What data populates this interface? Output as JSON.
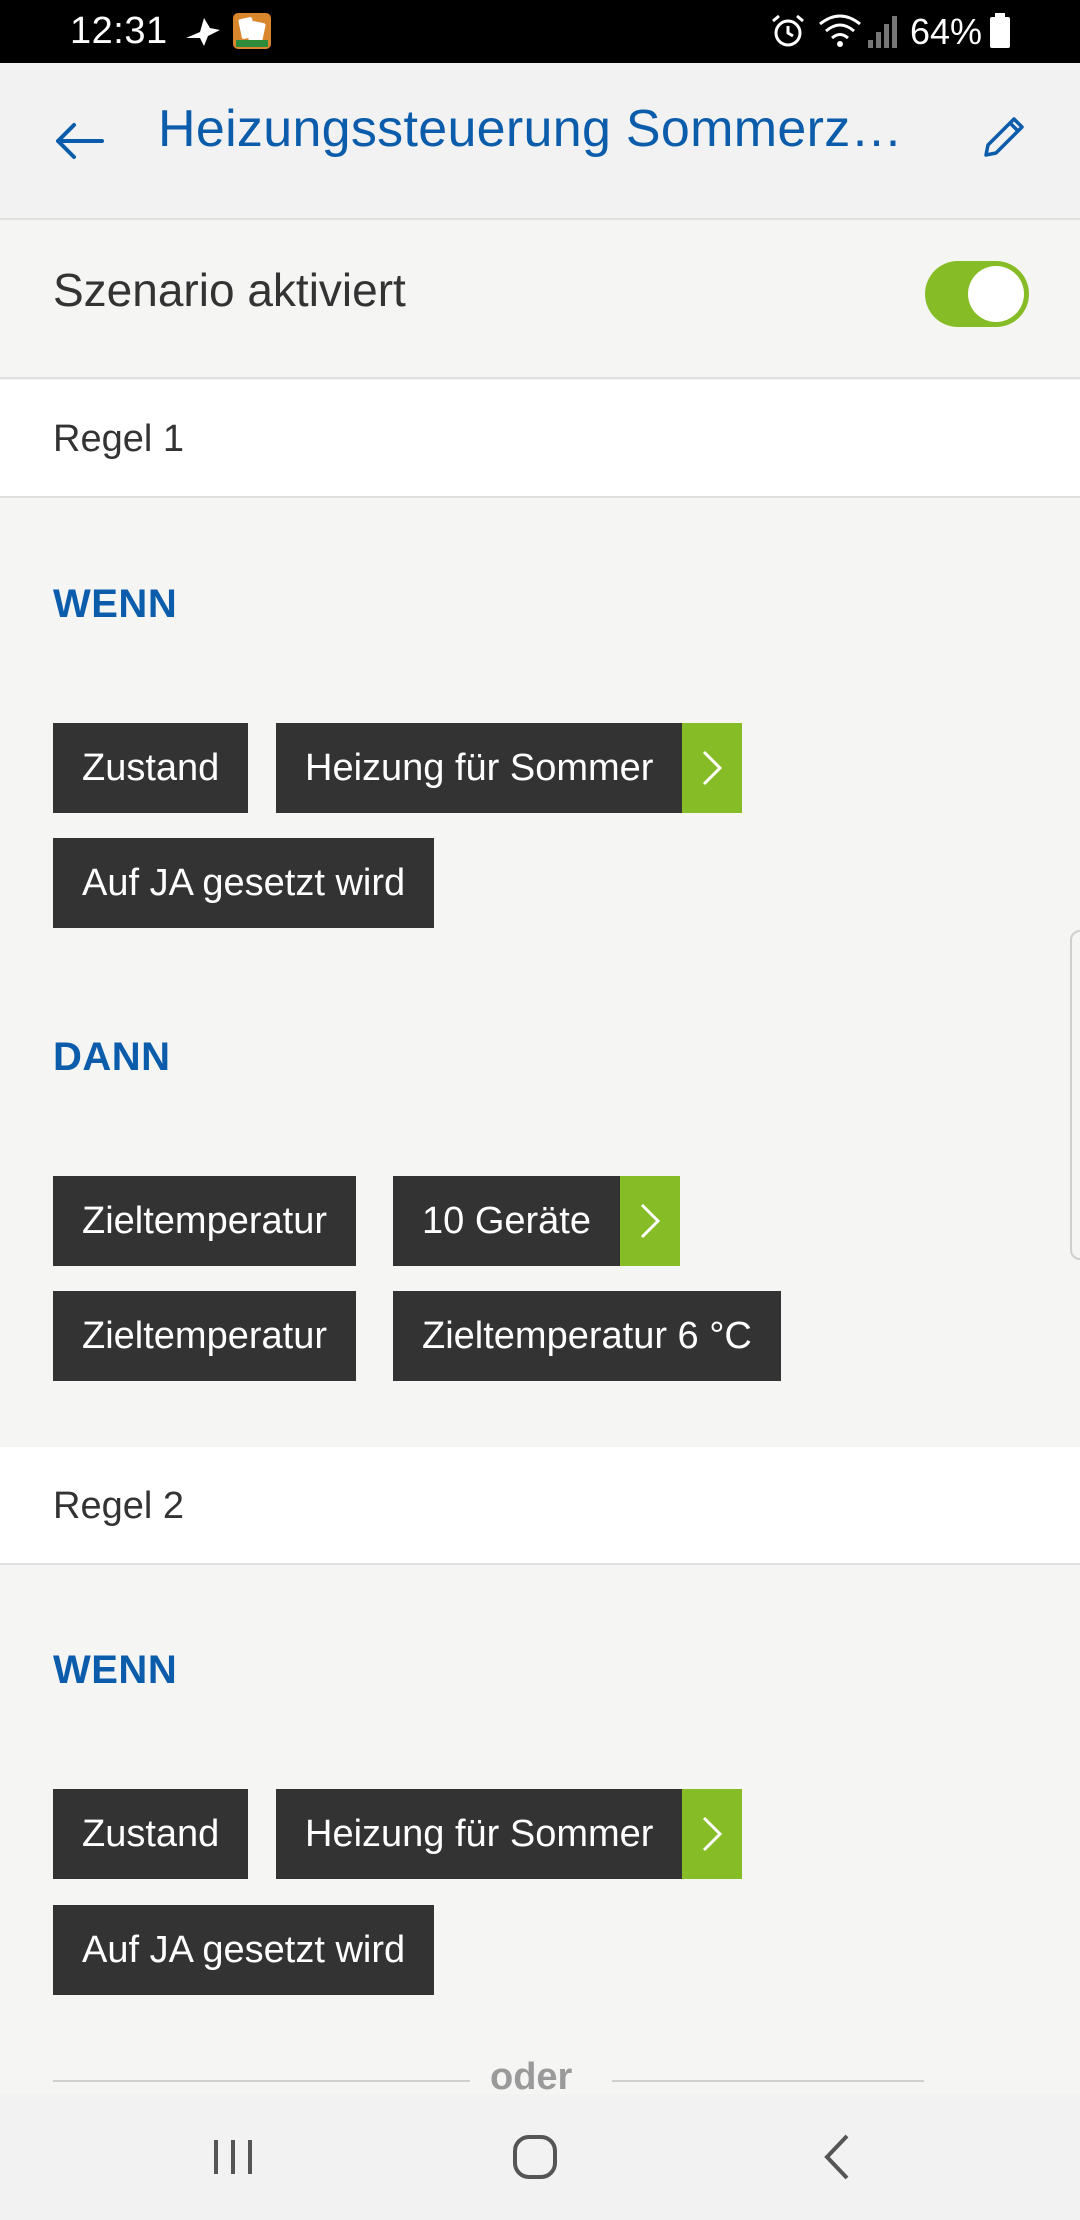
{
  "status_bar": {
    "time": "12:31",
    "battery": "64%",
    "icons": [
      "bird-app-icon",
      "solitaire-app-icon",
      "alarm-icon",
      "wifi-icon",
      "signal-icon",
      "battery-icon"
    ]
  },
  "app_bar": {
    "title": "Heizungssteuerung Sommerz…",
    "back_icon": "arrow-left-icon",
    "edit_icon": "pencil-icon"
  },
  "scenario": {
    "label": "Szenario aktiviert",
    "enabled": true
  },
  "rules": [
    {
      "label": "Regel 1",
      "when_heading": "WENN",
      "when_chips": [
        "Zustand",
        "Heizung für Sommer",
        "Auf JA gesetzt wird"
      ],
      "then_heading": "DANN",
      "then_chips": [
        "Zieltemperatur",
        "10 Geräte",
        "Zieltemperatur",
        "Zieltemperatur 6 °C"
      ]
    },
    {
      "label": "Regel 2",
      "when_heading": "WENN",
      "when_chips": [
        "Zustand",
        "Heizung für Sommer",
        "Auf JA gesetzt wird"
      ]
    }
  ],
  "separator_text": "oder",
  "colors": {
    "accent_blue": "#0b5cab",
    "accent_green": "#86bc25",
    "chip_dark": "#333333"
  }
}
